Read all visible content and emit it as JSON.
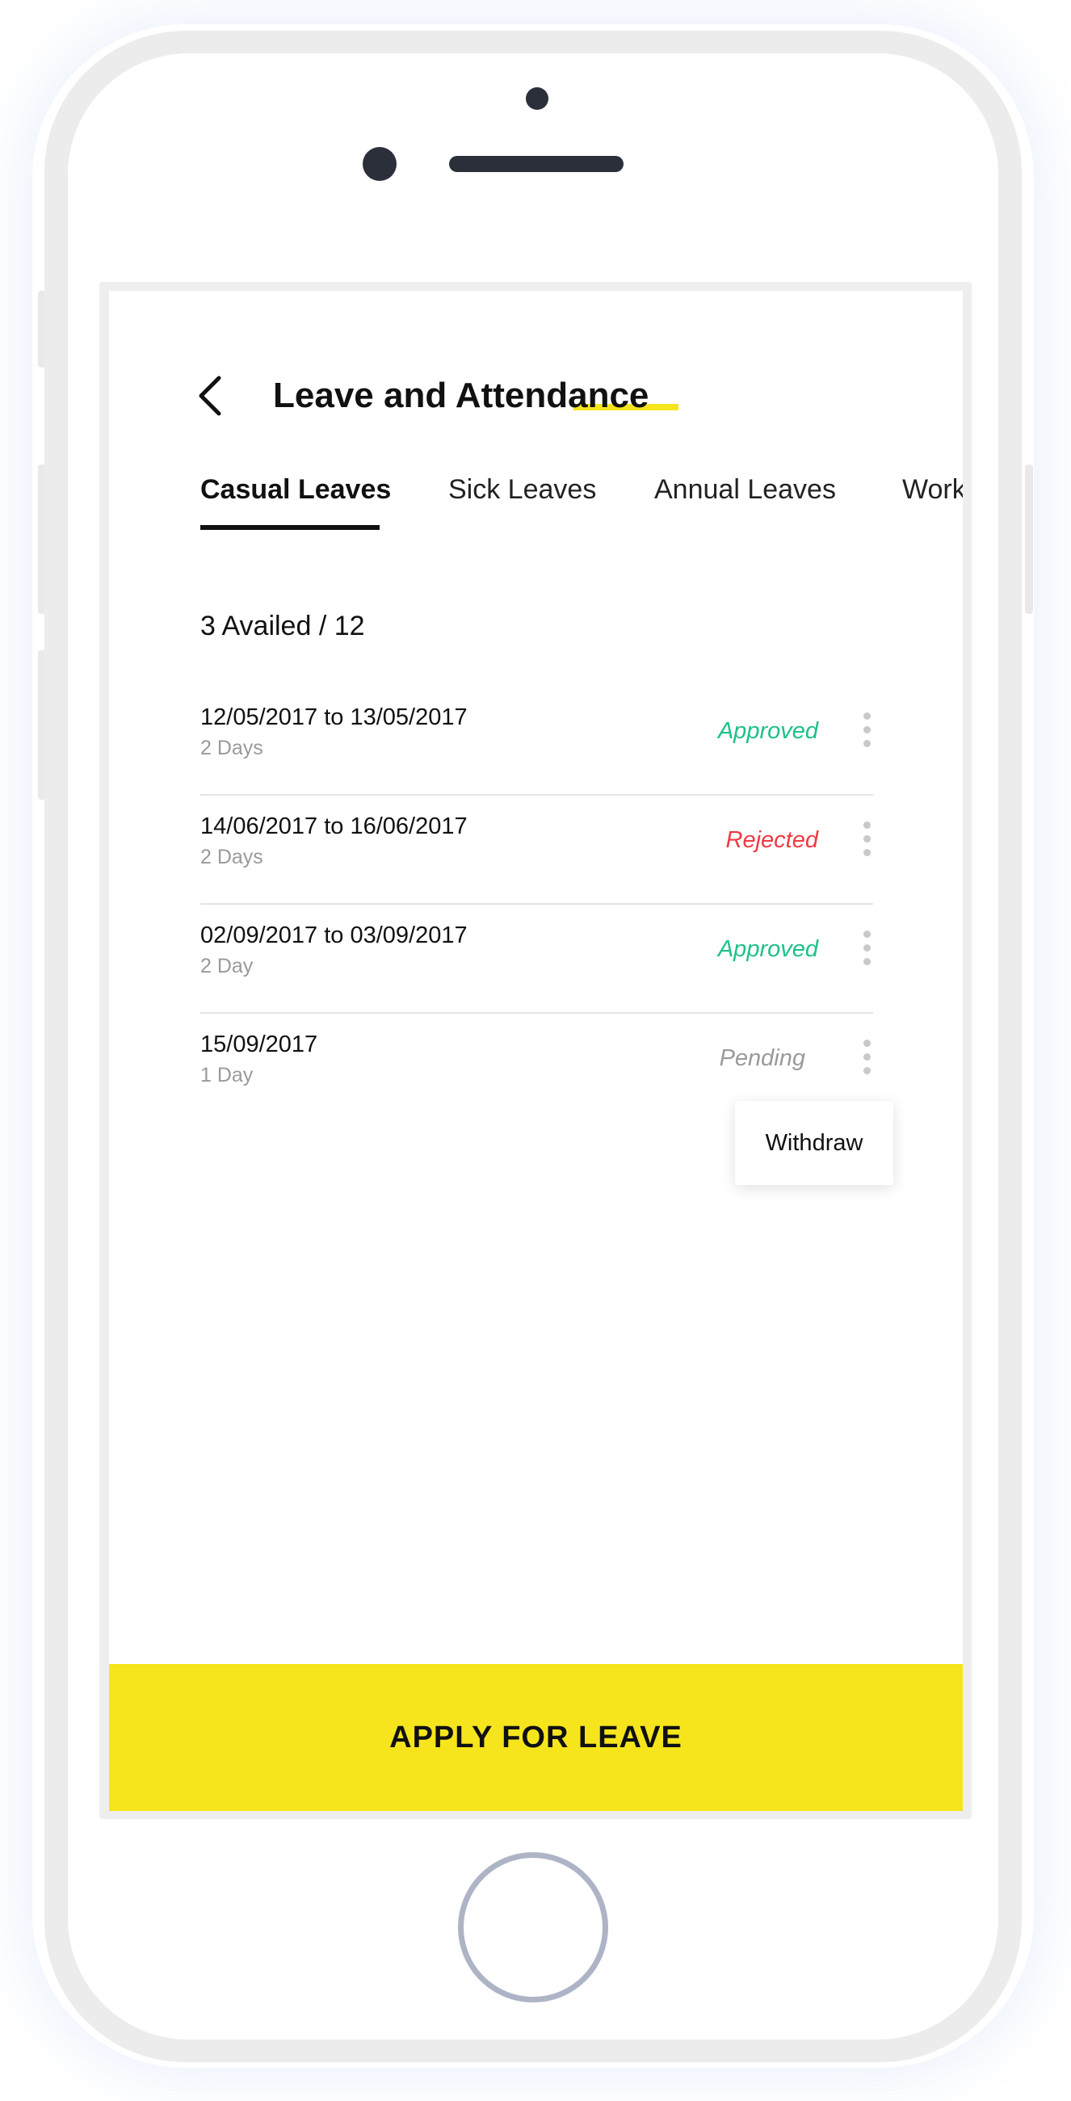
{
  "header": {
    "title": "Leave and Attendance",
    "accent_color": "#f6e51d"
  },
  "tabs": [
    {
      "label": "Casual Leaves",
      "active": true
    },
    {
      "label": "Sick Leaves",
      "active": false
    },
    {
      "label": "Annual Leaves",
      "active": false
    },
    {
      "label": "Work",
      "active": false
    }
  ],
  "summary": "3 Availed / 12",
  "leaves": [
    {
      "dates": "12/05/2017 to 13/05/2017",
      "duration": "2 Days",
      "status": "Approved",
      "status_color": "#1fc18b"
    },
    {
      "dates": "14/06/2017 to 16/06/2017",
      "duration": "2 Days",
      "status": "Rejected",
      "status_color": "#ee3a45"
    },
    {
      "dates": "02/09/2017 to 03/09/2017",
      "duration": "2 Day",
      "status": "Approved",
      "status_color": "#1fc18b"
    },
    {
      "dates": "15/09/2017",
      "duration": "1 Day",
      "status": "Pending",
      "status_color": "#9a9a9a"
    }
  ],
  "menu": {
    "withdraw_label": "Withdraw"
  },
  "footer": {
    "apply_label": "APPLY FOR LEAVE",
    "button_color": "#f6e51d"
  }
}
